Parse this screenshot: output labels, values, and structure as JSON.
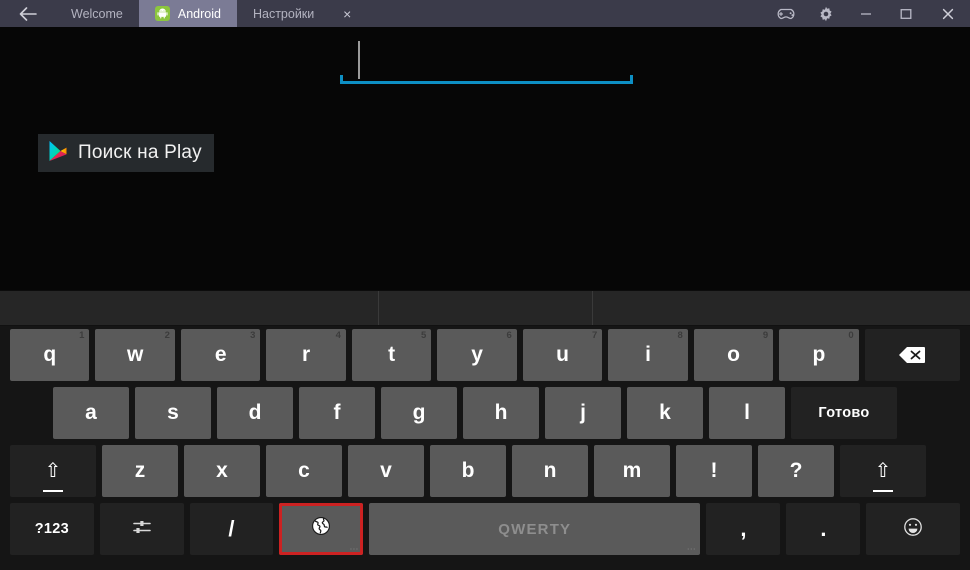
{
  "titlebar": {
    "back_icon": "arrow-left-icon",
    "tabs": [
      {
        "label": "Welcome",
        "icon": null,
        "active": false
      },
      {
        "label": "Android",
        "icon": "android-robot-icon",
        "active": true
      },
      {
        "label": "Настройки",
        "icon": null,
        "active": false
      }
    ],
    "close_tab_label": "×",
    "controls": [
      {
        "name": "gamepad-icon",
        "label": ""
      },
      {
        "name": "gear-icon",
        "label": ""
      },
      {
        "name": "minimize-icon",
        "label": "—"
      },
      {
        "name": "maximize-icon",
        "label": "□"
      },
      {
        "name": "window-close-icon",
        "label": "✕"
      }
    ]
  },
  "screen": {
    "search_field": {
      "value": "",
      "caret_visible": true,
      "underline_color": "#0d8fc4"
    },
    "play_button": {
      "label": "Поиск на Play",
      "icon": "google-play-icon"
    },
    "background_color": "#060606"
  },
  "keyboard": {
    "suggestions": [
      "",
      "",
      ""
    ],
    "row1": [
      {
        "label": "q",
        "sup": "1"
      },
      {
        "label": "w",
        "sup": "2"
      },
      {
        "label": "e",
        "sup": "3"
      },
      {
        "label": "r",
        "sup": "4"
      },
      {
        "label": "t",
        "sup": "5"
      },
      {
        "label": "y",
        "sup": "6"
      },
      {
        "label": "u",
        "sup": "7"
      },
      {
        "label": "i",
        "sup": "8"
      },
      {
        "label": "o",
        "sup": "9"
      },
      {
        "label": "p",
        "sup": "0"
      }
    ],
    "backspace": {
      "name": "backspace-key",
      "label": ""
    },
    "row2": [
      {
        "label": "a"
      },
      {
        "label": "s"
      },
      {
        "label": "d"
      },
      {
        "label": "f"
      },
      {
        "label": "g"
      },
      {
        "label": "h"
      },
      {
        "label": "j"
      },
      {
        "label": "k"
      },
      {
        "label": "l"
      }
    ],
    "done_key": {
      "label": "Готово"
    },
    "row3": [
      {
        "label": "z"
      },
      {
        "label": "x"
      },
      {
        "label": "c"
      },
      {
        "label": "v"
      },
      {
        "label": "b"
      },
      {
        "label": "n"
      },
      {
        "label": "m"
      },
      {
        "label": "!"
      },
      {
        "label": "?"
      }
    ],
    "shift_left": {
      "label": "⇧"
    },
    "shift_right": {
      "label": "⇧"
    },
    "row4": {
      "symbols_key": {
        "label": "?123"
      },
      "settings_key": {
        "label": "",
        "icon": "sliders-icon"
      },
      "slash_key": {
        "label": "/"
      },
      "language_key": {
        "label": "",
        "icon": "globe-icon",
        "selected": true,
        "highlight_color": "#cc2222"
      },
      "space_key": {
        "label": "QWERTY"
      },
      "comma_key": {
        "label": ","
      },
      "period_key": {
        "label": "."
      },
      "emoji_key": {
        "label": "",
        "icon": "smiley-icon"
      }
    }
  }
}
